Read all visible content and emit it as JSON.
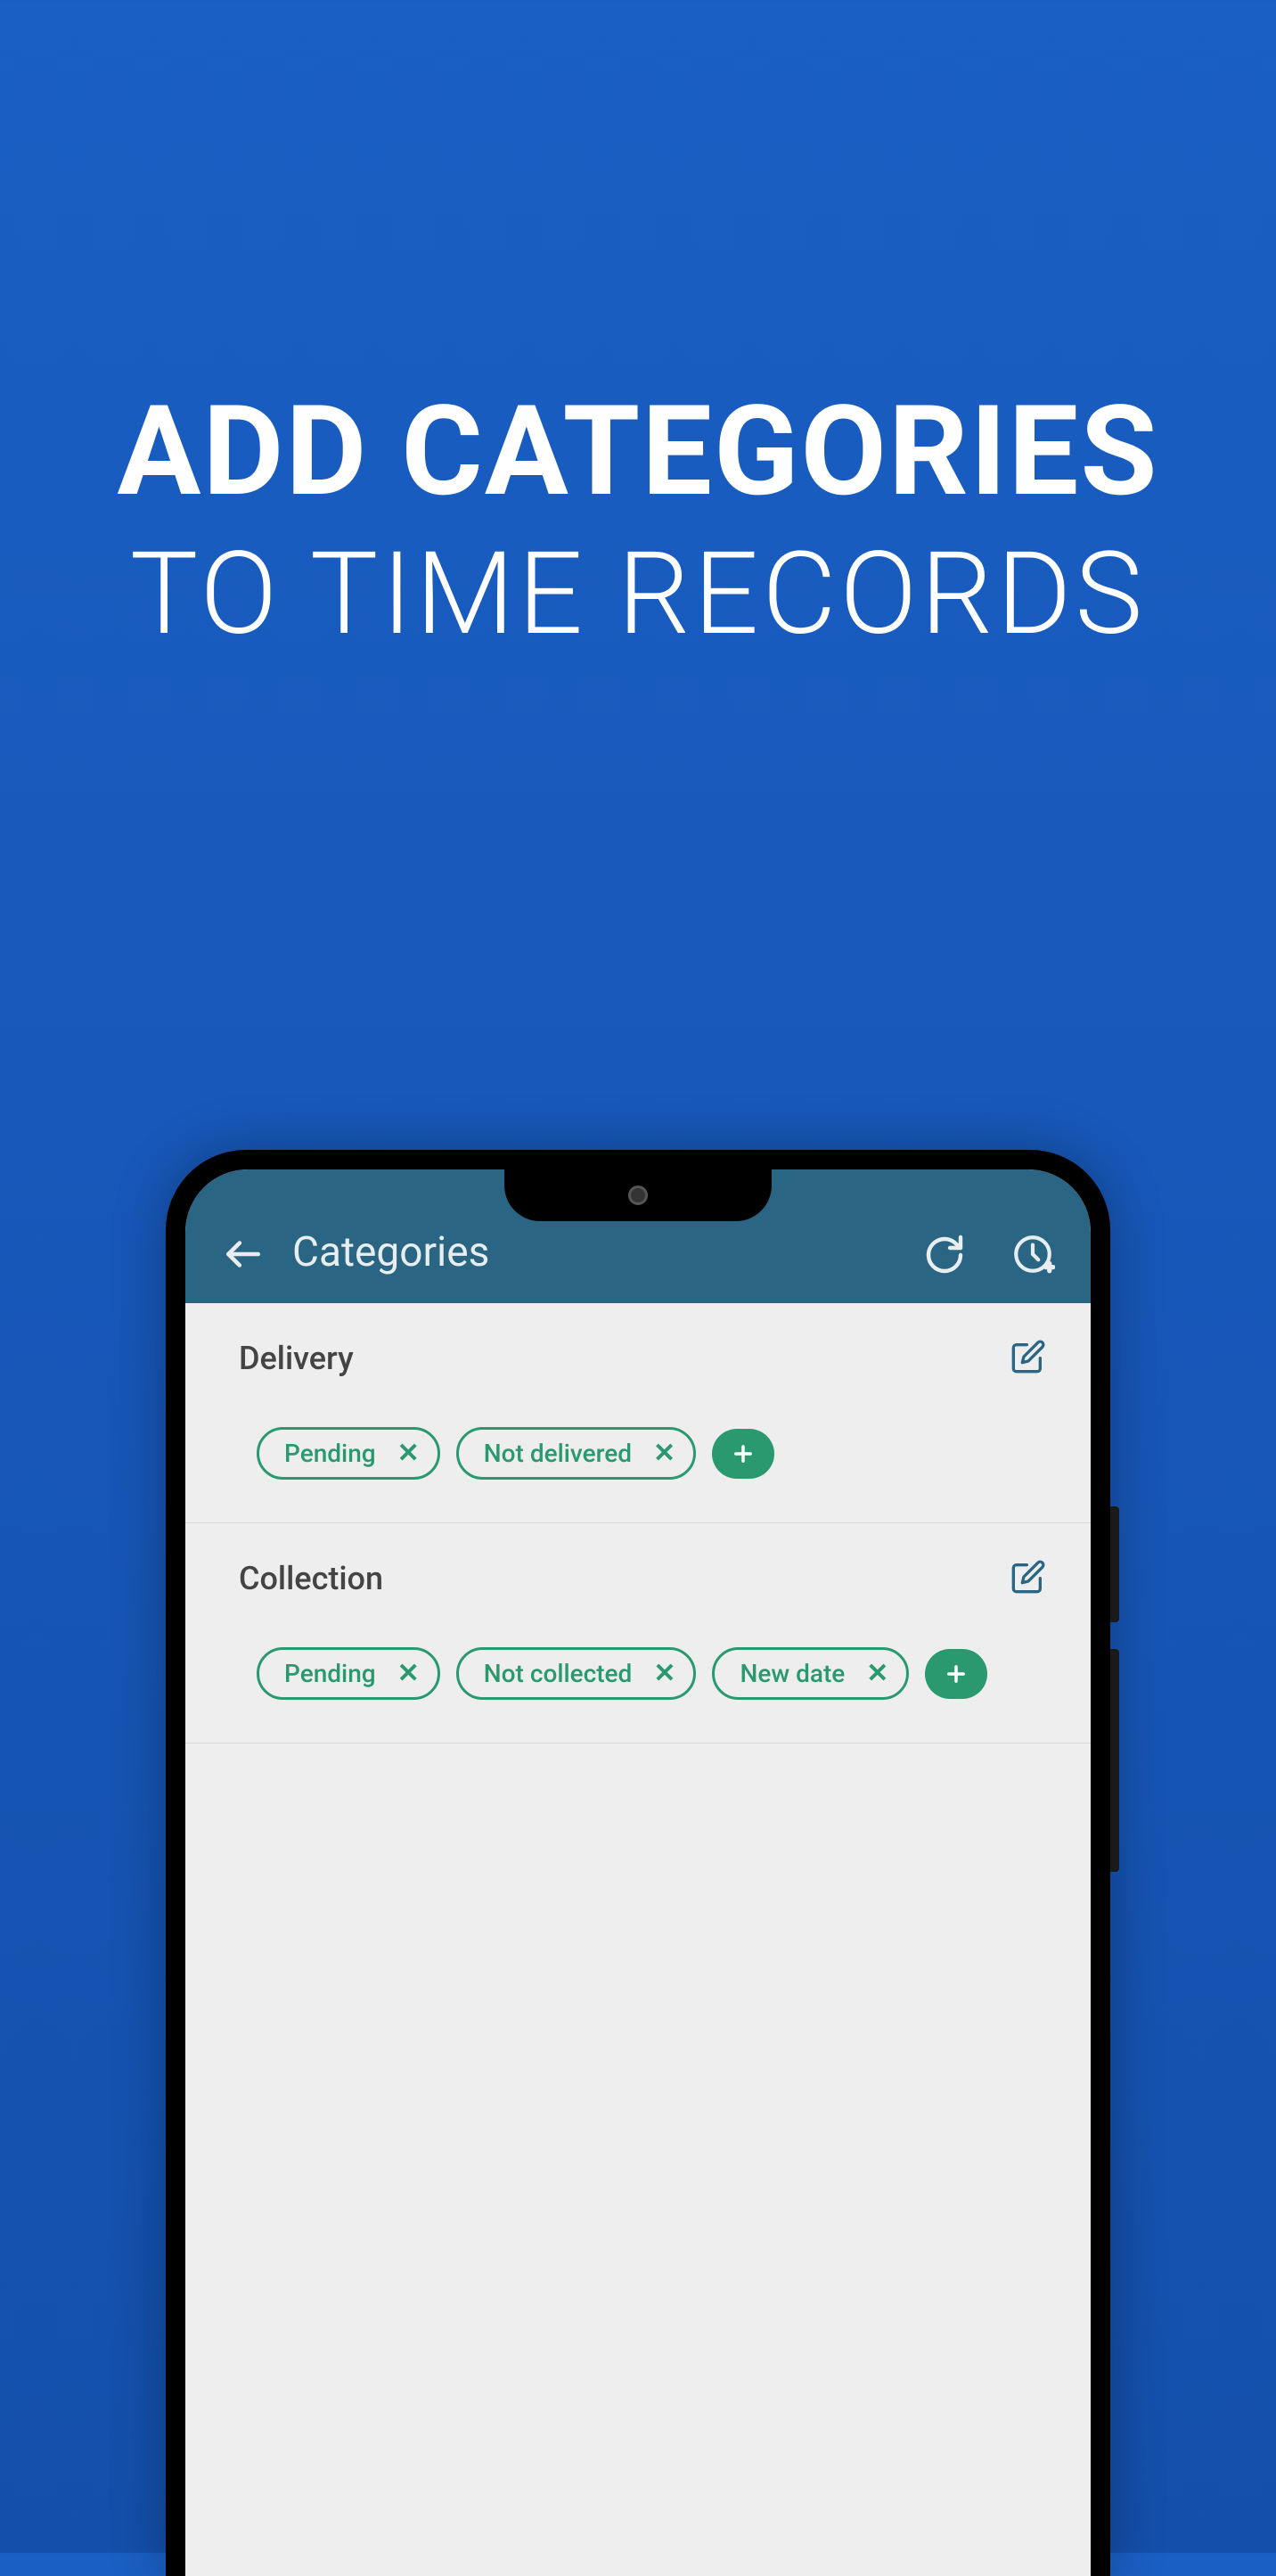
{
  "promo": {
    "line1": "ADD CATEGORIES",
    "line2": "TO TIME RECORDS"
  },
  "app_bar": {
    "title": "Categories"
  },
  "sections": [
    {
      "title": "Delivery",
      "chips": [
        "Pending",
        "Not delivered"
      ]
    },
    {
      "title": "Collection",
      "chips": [
        "Pending",
        "Not collected",
        "New date"
      ]
    }
  ]
}
